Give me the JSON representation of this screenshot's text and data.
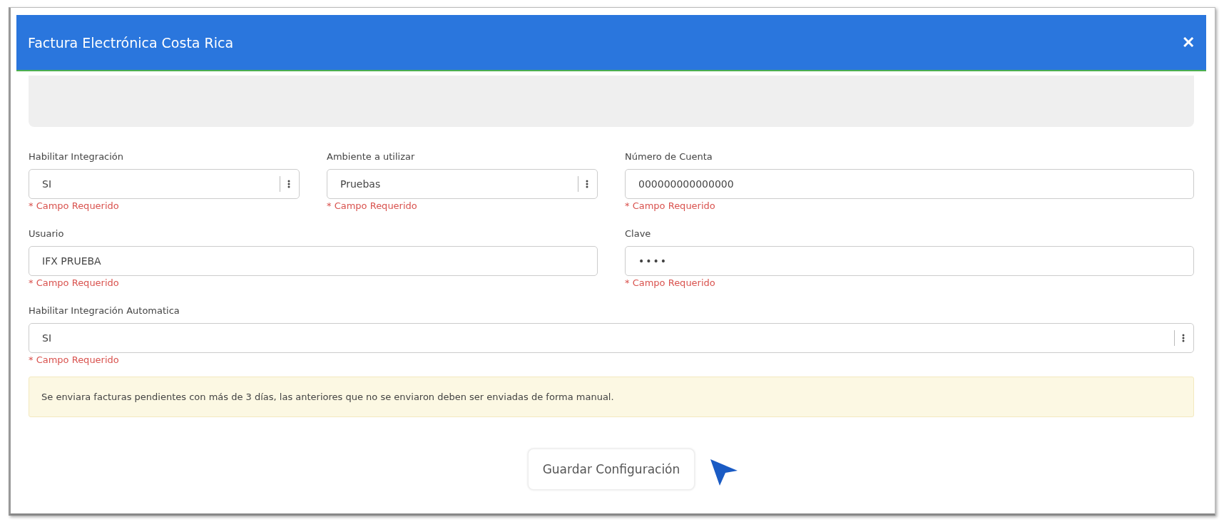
{
  "window": {
    "title": "Factura Electrónica Costa Rica",
    "close": "✕"
  },
  "rows": [
    {
      "fields": [
        {
          "kind": "select",
          "label": "Habilitar Integración",
          "value": "SI",
          "error": "* Campo Requerido"
        },
        {
          "kind": "select",
          "label": "Ambiente a utilizar",
          "value": "Pruebas",
          "error": "* Campo Requerido"
        },
        {
          "kind": "input",
          "label": "Número de Cuenta",
          "value": "000000000000000",
          "error": "* Campo Requerido"
        }
      ]
    },
    {
      "fields": [
        {
          "kind": "input",
          "label": "Usuario",
          "value": "IFX PRUEBA",
          "error": "* Campo Requerido"
        },
        {
          "kind": "password",
          "label": "Clave",
          "value": "••••",
          "error": "* Campo Requerido"
        }
      ]
    },
    {
      "fields": [
        {
          "kind": "select",
          "label": "Habilitar Integración Automatica",
          "value": "SI",
          "error": "* Campo Requerido"
        }
      ]
    }
  ],
  "notice": "Se enviara facturas pendientes con más de 3 días, las anteriores que no se enviaron deben ser enviadas de forma manual.",
  "save_button": "Guardar Configuración"
}
